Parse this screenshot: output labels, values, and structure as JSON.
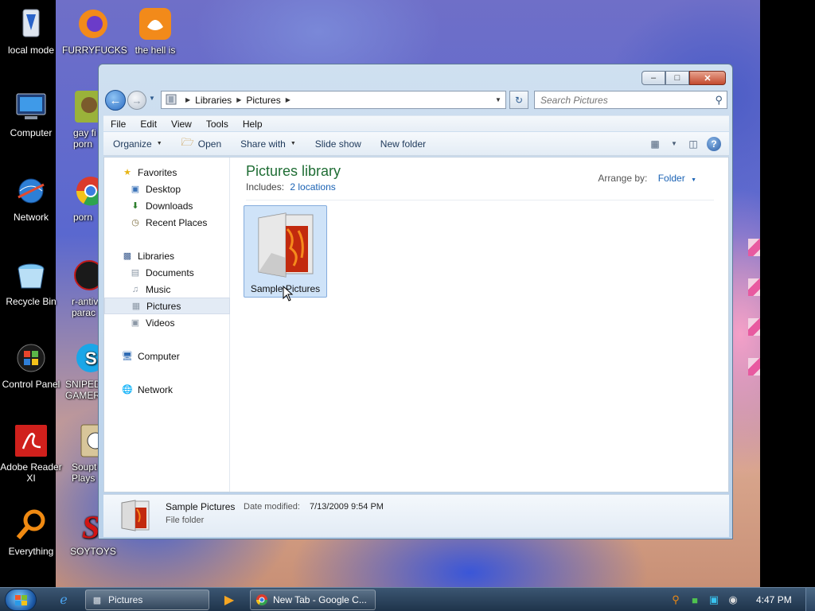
{
  "desktop": {
    "icons_left": [
      {
        "label": "local mode"
      },
      {
        "label": "Computer"
      },
      {
        "label": "Network"
      },
      {
        "label": "Recycle Bin"
      },
      {
        "label": "Control Panel"
      },
      {
        "label": "Adobe Reader XI"
      },
      {
        "label": "Everything"
      }
    ],
    "icons_second": [
      {
        "label": "FURRYFUCKS"
      },
      {
        "label": "the hell is"
      },
      {
        "label": "gay fi porn"
      },
      {
        "label": "porn"
      },
      {
        "label": "r-antiv parac"
      },
      {
        "label": "SNIPED! GAMER"
      },
      {
        "label": "Soupt Plays"
      },
      {
        "label": "SOYTOYS"
      }
    ]
  },
  "window": {
    "title": "Pictures",
    "address": {
      "crumbs": [
        "Libraries",
        "Pictures"
      ]
    },
    "search": {
      "placeholder": "Search Pictures"
    },
    "menu": [
      "File",
      "Edit",
      "View",
      "Tools",
      "Help"
    ],
    "toolbar": {
      "organize": "Organize",
      "open": "Open",
      "share_with": "Share with",
      "slide_show": "Slide show",
      "new_folder": "New folder"
    },
    "nav": {
      "favorites": {
        "label": "Favorites",
        "items": [
          "Desktop",
          "Downloads",
          "Recent Places"
        ]
      },
      "libraries": {
        "label": "Libraries",
        "items": [
          "Documents",
          "Music",
          "Pictures",
          "Videos"
        ]
      },
      "computer": "Computer",
      "network": "Network"
    },
    "library": {
      "title": "Pictures library",
      "includes_label": "Includes:",
      "locations_link": "2 locations",
      "arrange_label": "Arrange by:",
      "arrange_value": "Folder"
    },
    "items": [
      {
        "name": "Sample Pictures"
      }
    ],
    "details": {
      "name": "Sample Pictures",
      "date_label": "Date modified:",
      "date_value": "7/13/2009 9:54 PM",
      "type": "File folder"
    }
  },
  "taskbar": {
    "pictures_label": "Pictures",
    "chrome_label": "New Tab - Google C...",
    "clock": "4:47 PM"
  },
  "colors": {
    "library_title": "#1f6d34",
    "link": "#1a62b4",
    "selection": "#cfe3f8"
  }
}
